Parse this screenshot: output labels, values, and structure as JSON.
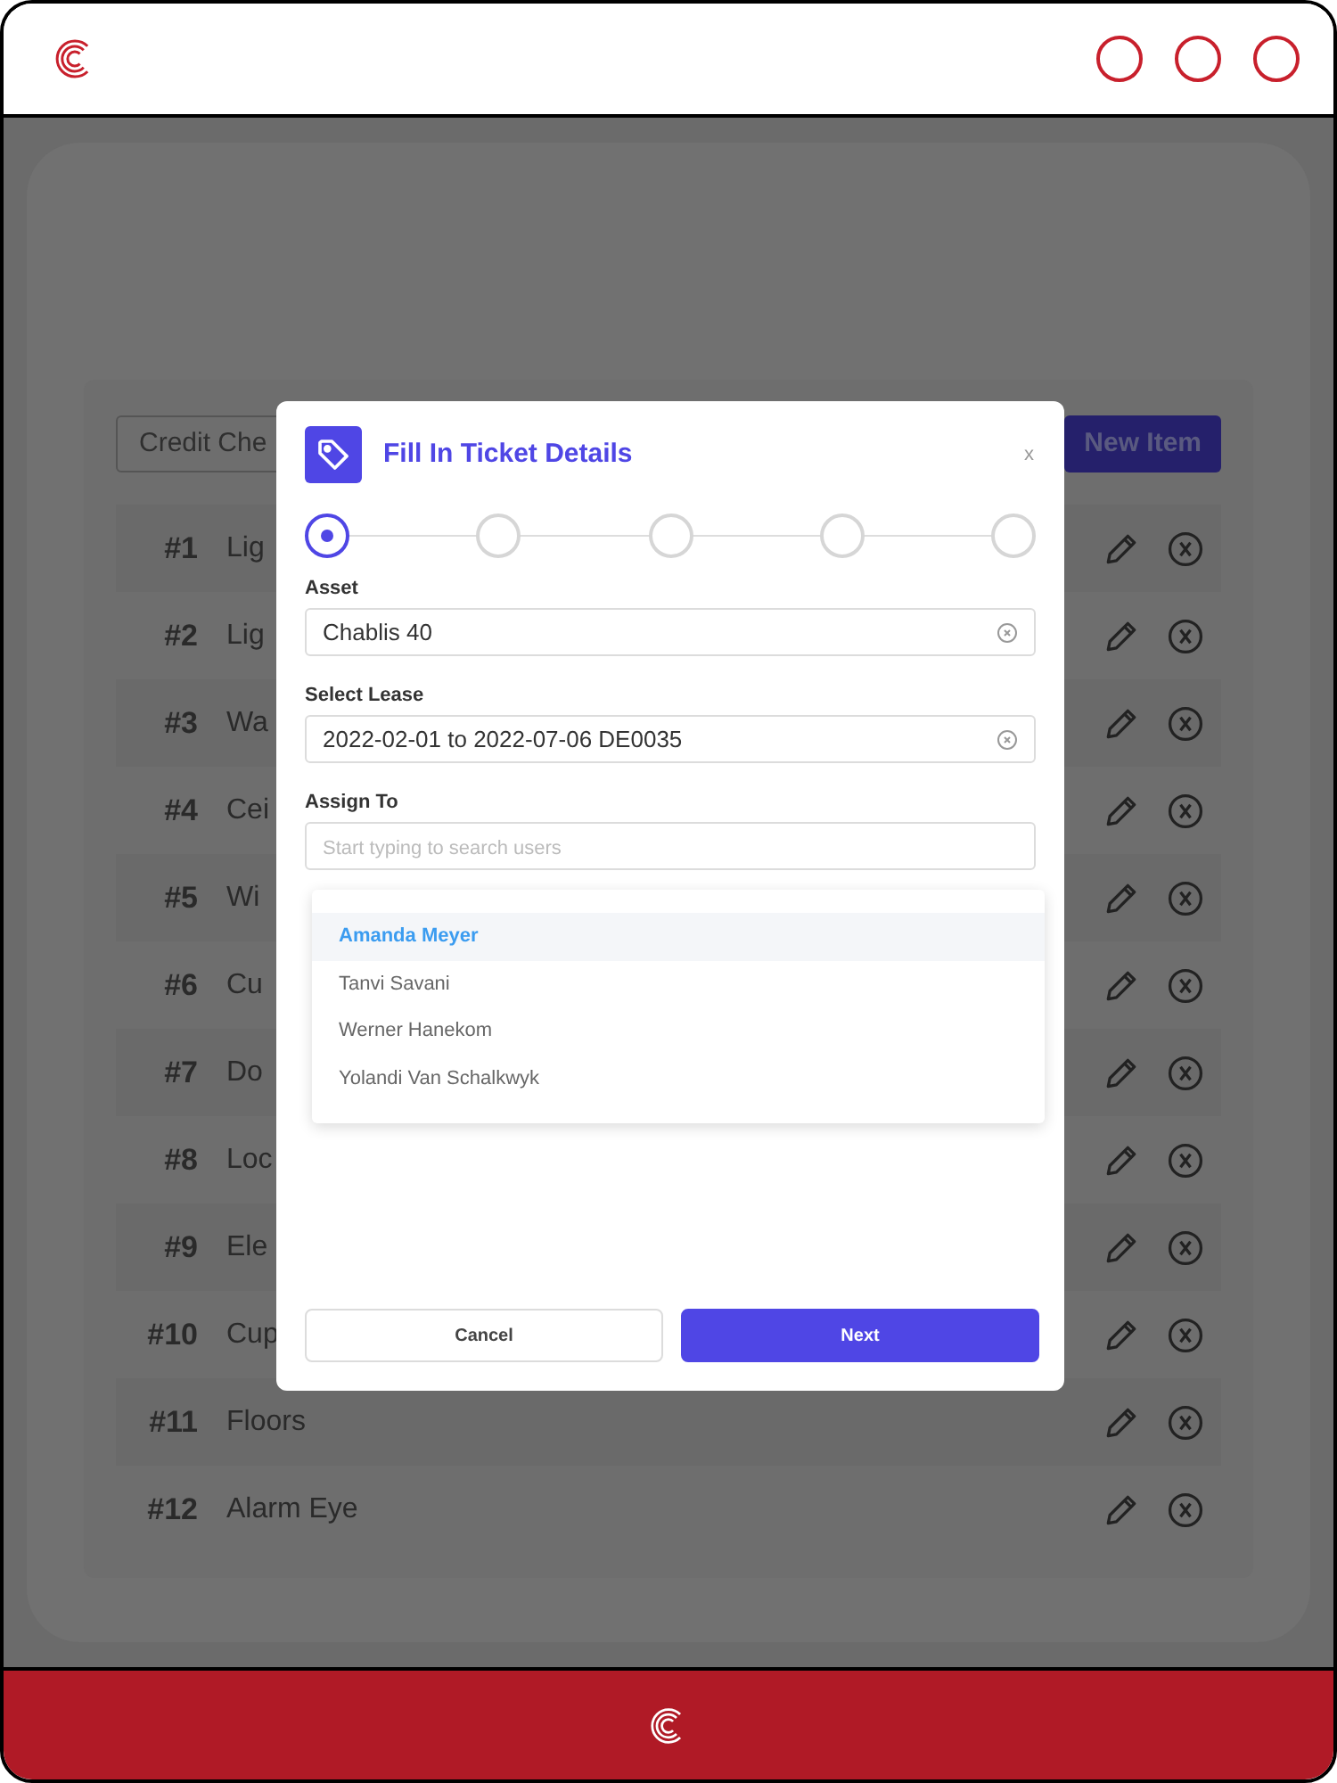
{
  "background": {
    "search": {
      "value": "Credit Che"
    },
    "new_item_button": "New Item",
    "rows": [
      {
        "number": "#1",
        "name": "Lig"
      },
      {
        "number": "#2",
        "name": "Lig"
      },
      {
        "number": "#3",
        "name": "Wa"
      },
      {
        "number": "#4",
        "name": "Cei"
      },
      {
        "number": "#5",
        "name": "Wi"
      },
      {
        "number": "#6",
        "name": "Cu"
      },
      {
        "number": "#7",
        "name": "Do"
      },
      {
        "number": "#8",
        "name": "Loc"
      },
      {
        "number": "#9",
        "name": "Ele"
      },
      {
        "number": "#10",
        "name": "Cup"
      },
      {
        "number": "#11",
        "name": "Floors"
      },
      {
        "number": "#12",
        "name": "Alarm Eye"
      }
    ]
  },
  "modal": {
    "title": "Fill In Ticket Details",
    "close": "x",
    "steps": [
      {
        "selected": true
      },
      {
        "selected": false
      },
      {
        "selected": false
      },
      {
        "selected": false
      },
      {
        "selected": false
      }
    ],
    "fields": [
      {
        "label": "Asset",
        "value": "Chablis 40",
        "clearable": true
      },
      {
        "label": "Select Lease",
        "value": "2022-02-01 to 2022-07-06 DE0035",
        "clearable": true
      },
      {
        "label": "Assign To",
        "placeholder": "Start typing to search users",
        "clearable": false
      }
    ],
    "suggestions": [
      {
        "name": "Amanda Meyer",
        "selected": true
      },
      {
        "name": "Tanvi Savani",
        "selected": false
      },
      {
        "name": "Werner Hanekom",
        "selected": false
      },
      {
        "name": "Yolandi Van Schalkwyk",
        "selected": false
      }
    ],
    "buttons": [
      {
        "kind": "secondary",
        "label": "Cancel"
      },
      {
        "kind": "primary",
        "label": "Next"
      }
    ]
  }
}
